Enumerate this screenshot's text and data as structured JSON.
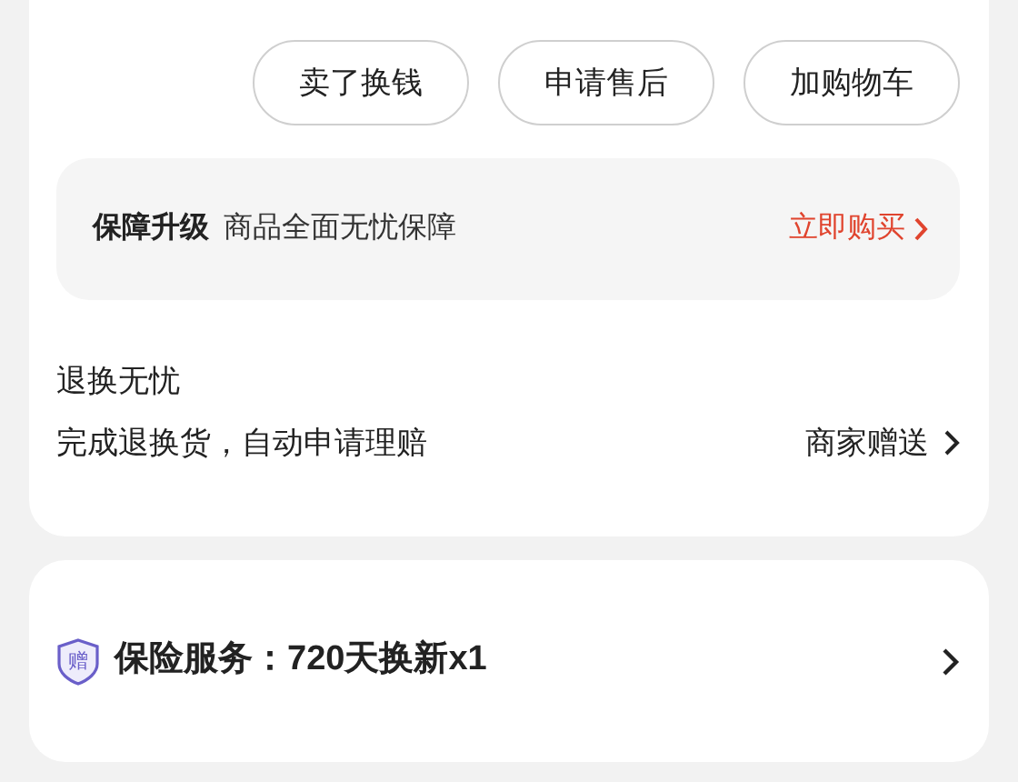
{
  "action_buttons": [
    "卖了换钱",
    "申请售后",
    "加购物车"
  ],
  "upgrade": {
    "title": "保障升级",
    "description": "商品全面无忧保障",
    "link": "立即购买"
  },
  "return_service": {
    "title": "退换无忧",
    "description": "完成退换货，自动申请理赔",
    "note": "商家赠送"
  },
  "insurance": {
    "badge": "赠",
    "label": "保险服务：",
    "value": "720天换新x1"
  }
}
